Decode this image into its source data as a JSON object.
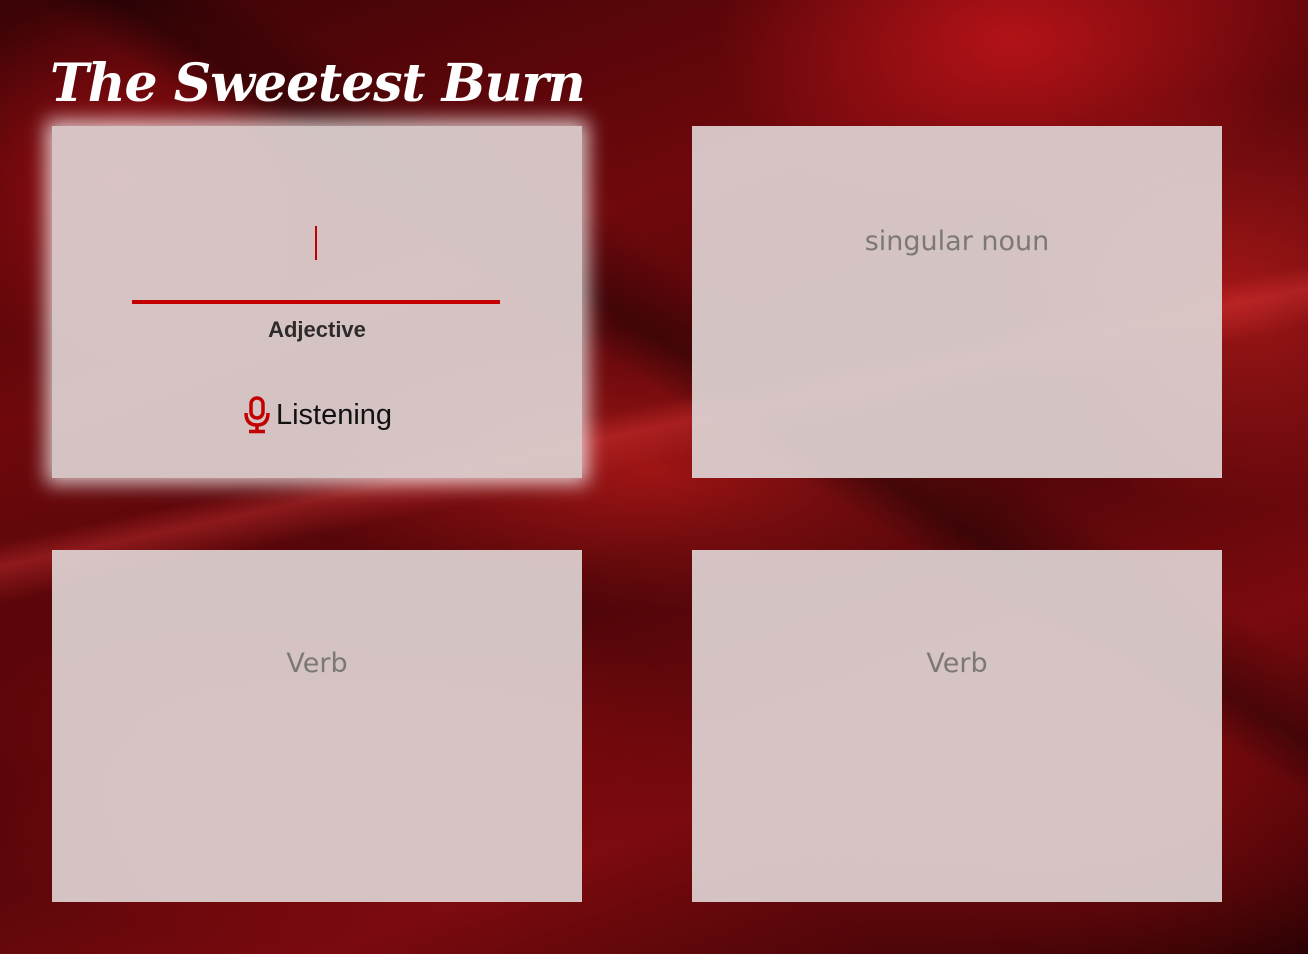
{
  "app": {
    "title": "The Sweetest Burn"
  },
  "colors": {
    "accent": "#c20000",
    "card_background": "#ded2d2",
    "placeholder_text": "#7d7878"
  },
  "cards": [
    {
      "part_of_speech": "Adjective",
      "input_value": "",
      "status_icon": "microphone-icon",
      "status_text": "Listening",
      "active": true
    },
    {
      "placeholder": "singular noun",
      "active": false
    },
    {
      "placeholder": "Verb",
      "active": false
    },
    {
      "placeholder": "Verb",
      "active": false
    }
  ]
}
